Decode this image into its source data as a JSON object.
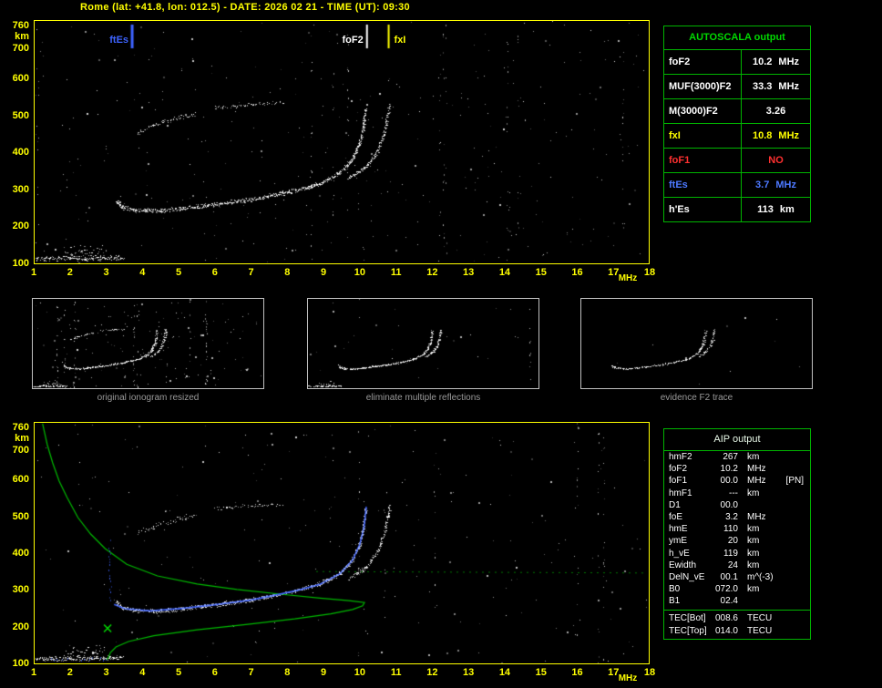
{
  "header": {
    "title": "Rome (lat: +41.8, lon: 012.5) - DATE: 2026 02 21 - TIME (UT): 09:30"
  },
  "autoscala_panel": {
    "title": "AUTOSCALA output",
    "rows": [
      {
        "label": "foF2",
        "value": "10.2",
        "unit": "MHz",
        "color": "#ffffff"
      },
      {
        "label": "MUF(3000)F2",
        "value": "33.3",
        "unit": "MHz",
        "color": "#ffffff"
      },
      {
        "label": "M(3000)F2",
        "value": "3.26",
        "unit": "",
        "color": "#ffffff"
      },
      {
        "label": "fxI",
        "value": "10.8",
        "unit": "MHz",
        "color": "#ffff00"
      },
      {
        "label": "foF1",
        "value": "NO",
        "unit": "",
        "color": "#ff3030"
      },
      {
        "label": "ftEs",
        "value": "3.7",
        "unit": "MHz",
        "color": "#4d79ff"
      },
      {
        "label": "h'Es",
        "value": "113",
        "unit": "km",
        "color": "#ffffff"
      }
    ]
  },
  "aip_panel": {
    "title": "AIP output",
    "rows": [
      {
        "label": "hmF2",
        "value": "267",
        "unit": "km",
        "extra": ""
      },
      {
        "label": "foF2",
        "value": "10.2",
        "unit": "MHz",
        "extra": ""
      },
      {
        "label": "foF1",
        "value": "00.0",
        "unit": "MHz",
        "extra": "[PN]"
      },
      {
        "label": "hmF1",
        "value": "---",
        "unit": "km",
        "extra": ""
      },
      {
        "label": "D1",
        "value": "00.0",
        "unit": "",
        "extra": ""
      },
      {
        "label": "foE",
        "value": "3.2",
        "unit": "MHz",
        "extra": ""
      },
      {
        "label": "hmE",
        "value": "110",
        "unit": "km",
        "extra": ""
      },
      {
        "label": "ymE",
        "value": "20",
        "unit": "km",
        "extra": ""
      },
      {
        "label": "h_vE",
        "value": "119",
        "unit": "km",
        "extra": ""
      },
      {
        "label": "Ewidth",
        "value": "24",
        "unit": "km",
        "extra": ""
      },
      {
        "label": "DelN_vE",
        "value": "00.1",
        "unit": "m^(-3)",
        "extra": ""
      },
      {
        "label": "B0",
        "value": "072.0",
        "unit": "km",
        "extra": ""
      },
      {
        "label": "B1",
        "value": "02.4",
        "unit": "",
        "extra": ""
      }
    ],
    "tec_rows": [
      {
        "label": "TEC[Bot]",
        "value": "008.6",
        "unit": "TECU"
      },
      {
        "label": "TEC[Top]",
        "value": "014.0",
        "unit": "TECU"
      }
    ]
  },
  "thumbnails": [
    {
      "caption": "original ionogram resized"
    },
    {
      "caption": "eliminate multiple reflections"
    },
    {
      "caption": "evidence F2 trace"
    }
  ],
  "chart_data": {
    "type": "scatter",
    "x_unit": "MHz",
    "y_unit": "km",
    "xlim": [
      1,
      18
    ],
    "ylim": [
      100,
      760
    ],
    "x_ticks": [
      1,
      2,
      3,
      4,
      5,
      6,
      7,
      8,
      9,
      10,
      11,
      12,
      13,
      14,
      15,
      16,
      17,
      18
    ],
    "y_ticks": [
      760,
      700,
      600,
      500,
      400,
      300,
      200,
      100
    ],
    "markers": [
      {
        "label": "ftEs",
        "mhz": 3.7,
        "color": "#3d63ff",
        "label_side": "left"
      },
      {
        "label": "foF2",
        "mhz": 10.2,
        "color": "#ffffff",
        "label_side": "left"
      },
      {
        "label": "fxI",
        "mhz": 10.8,
        "color": "#ffff00",
        "label_side": "right"
      }
    ],
    "traces": {
      "es": {
        "pts": [
          [
            1.05,
            112
          ],
          [
            2.0,
            113
          ],
          [
            3.45,
            115
          ]
        ],
        "spread": 8,
        "density": 2.6
      },
      "es_blob": {
        "pts": [
          [
            1.85,
            128
          ],
          [
            2.95,
            132
          ]
        ],
        "spread": 24,
        "density": 1.5
      },
      "f_o": {
        "pts": [
          [
            3.28,
            268
          ],
          [
            3.42,
            252
          ],
          [
            3.8,
            244
          ],
          [
            4.5,
            242
          ],
          [
            5.1,
            249
          ],
          [
            6.0,
            260
          ],
          [
            7.0,
            273
          ],
          [
            7.6,
            285
          ],
          [
            8.3,
            300
          ],
          [
            8.9,
            316
          ],
          [
            9.45,
            345
          ],
          [
            9.8,
            382
          ],
          [
            10.0,
            425
          ],
          [
            10.1,
            470
          ],
          [
            10.17,
            520
          ]
        ],
        "spread": 7,
        "density": 3.0
      },
      "f_x": {
        "pts": [
          [
            9.7,
            330
          ],
          [
            10.2,
            365
          ],
          [
            10.5,
            405
          ],
          [
            10.68,
            455
          ],
          [
            10.78,
            505
          ],
          [
            10.84,
            532
          ]
        ],
        "spread": 6,
        "density": 2.2
      },
      "hop1": {
        "pts": [
          [
            3.85,
            455
          ],
          [
            4.3,
            476
          ],
          [
            4.9,
            494
          ],
          [
            5.45,
            507
          ]
        ],
        "spread": 9,
        "density": 1.3
      },
      "hop2": {
        "pts": [
          [
            6.0,
            524
          ],
          [
            7.0,
            532
          ],
          [
            7.85,
            537
          ]
        ],
        "spread": 6,
        "density": 1.1
      }
    },
    "profile": {
      "color": "#00c400",
      "pts": [
        [
          1.22,
          758
        ],
        [
          1.35,
          700
        ],
        [
          1.5,
          650
        ],
        [
          1.68,
          600
        ],
        [
          1.9,
          555
        ],
        [
          2.2,
          500
        ],
        [
          2.55,
          455
        ],
        [
          2.95,
          415
        ],
        [
          3.55,
          372
        ],
        [
          4.4,
          340
        ],
        [
          5.5,
          318
        ],
        [
          6.6,
          303
        ],
        [
          7.8,
          290
        ],
        [
          8.9,
          279
        ],
        [
          9.7,
          272
        ],
        [
          10.13,
          267
        ],
        [
          10.08,
          258
        ],
        [
          9.8,
          248
        ],
        [
          9.2,
          236
        ],
        [
          8.2,
          222
        ],
        [
          6.9,
          207
        ],
        [
          5.5,
          192
        ],
        [
          4.3,
          176
        ],
        [
          3.6,
          160
        ],
        [
          3.25,
          145
        ],
        [
          3.1,
          130
        ],
        [
          3.05,
          118
        ],
        [
          3.0,
          110
        ]
      ],
      "dotted": [
        [
          8.8,
          352
        ],
        [
          17.9,
          348
        ]
      ],
      "x_marker": [
        3.02,
        196
      ]
    },
    "fitted_trace": {
      "color": "#3f63ff",
      "pts": [
        [
          3.2,
          262
        ],
        [
          3.5,
          250
        ],
        [
          4.2,
          244
        ],
        [
          5.1,
          251
        ],
        [
          6.0,
          261
        ],
        [
          7.0,
          274
        ],
        [
          7.6,
          286
        ],
        [
          8.3,
          301
        ],
        [
          8.9,
          317
        ],
        [
          9.45,
          346
        ],
        [
          9.8,
          383
        ],
        [
          10.0,
          426
        ],
        [
          10.12,
          475
        ],
        [
          10.18,
          530
        ]
      ],
      "vertical": [
        [
          3.09,
          260
        ],
        [
          3.09,
          438
        ]
      ],
      "es_overlay": [
        [
          1.4,
          112
        ],
        [
          3.0,
          112
        ]
      ]
    }
  }
}
